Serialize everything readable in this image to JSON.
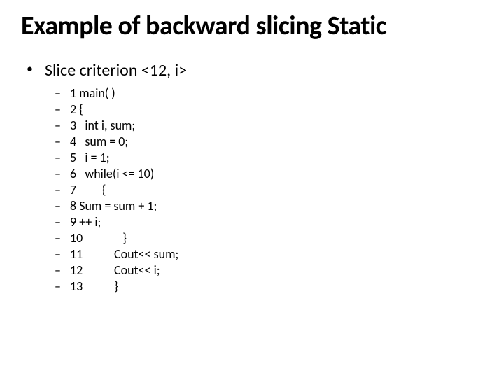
{
  "title": "Example of backward slicing Static",
  "bullet_l1": "Slice criterion <12, i>",
  "code_lines": [
    "1 main( )",
    "2 {",
    "3   int i, sum;",
    "4   sum = 0;",
    "5   i = 1;",
    "6   while(i <= 10)",
    "7         {",
    "8 Sum = sum + 1;",
    "9 ++ i;",
    "10              }",
    "11           Cout<< sum;",
    "12           Cout<< i;",
    "13           }"
  ]
}
